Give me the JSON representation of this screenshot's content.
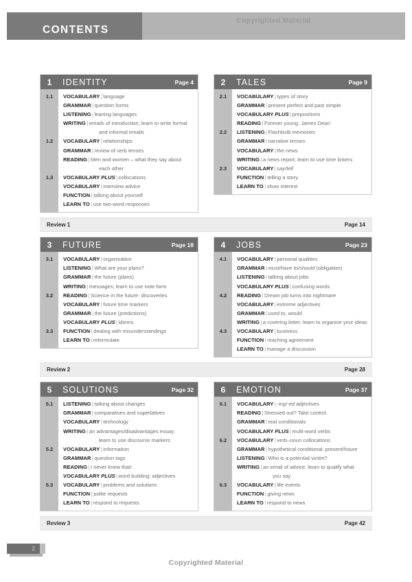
{
  "header": {
    "title": "CONTENTS",
    "watermark": "Copyrighted Material"
  },
  "footer": {
    "page_number": "2",
    "watermark": "Copyrighted Material"
  },
  "colors": {
    "header_dark": "#7a7a7a",
    "header_light": "#b3b3b3",
    "unit_head": "#6e6e6e",
    "lesson_col": "#bfbfbf",
    "review_bar": "#ececec"
  },
  "units": [
    {
      "number": "1",
      "title": "IDENTITY",
      "page_label": "Page 4",
      "lessons": [
        "1.1",
        "",
        "",
        "",
        "",
        "1.2",
        "",
        "",
        "",
        "1.3",
        "",
        ""
      ],
      "rows": [
        {
          "label": "VOCABULARY",
          "text": "language"
        },
        {
          "label": "GRAMMAR",
          "text": "question forms"
        },
        {
          "label": "LISTENING",
          "text": "leaning languages"
        },
        {
          "label": "WRITING",
          "text": "emails of introduction; learn to write formal",
          "cont": "and informal emails"
        },
        {
          "label": "VOCABULARY",
          "text": "relationships"
        },
        {
          "label": "GRAMMAR",
          "text": "review of verb tenses"
        },
        {
          "label": "READING",
          "text": "Men and women – what they say about",
          "cont": "each other"
        },
        {
          "label": "VOCABULARY PLUS",
          "text": "collocations"
        },
        {
          "label": "VOCABULARY",
          "text": "interview advice"
        },
        {
          "label": "FUNCTION",
          "text": "talking about yourself"
        },
        {
          "label": "LEARN TO",
          "text": "use two-word responses"
        }
      ]
    },
    {
      "number": "2",
      "title": "TALES",
      "page_label": "Page 9",
      "lessons": [
        "2.1",
        "",
        "",
        "",
        "2.2",
        "",
        "",
        "",
        "2.3",
        "",
        ""
      ],
      "rows": [
        {
          "label": "VOCABULARY",
          "text": "types of story"
        },
        {
          "label": "GRAMMAR",
          "text": "present perfect and past simple"
        },
        {
          "label": "VOCABULARY PLUS",
          "text": "prepositions"
        },
        {
          "label": "READING",
          "text": "Forever young: James Dean"
        },
        {
          "label": "LISTENING",
          "text": "Flashbulb memories"
        },
        {
          "label": "GRAMMAR",
          "text": "narrative tenses"
        },
        {
          "label": "VOCABULARY",
          "text": "the news"
        },
        {
          "label": "WRITING",
          "text": "a news report; learn to use time linkers"
        },
        {
          "label": "VOCABULARY",
          "text": "say/tell",
          "italic": true
        },
        {
          "label": "FUNCTION",
          "text": "telling a story"
        },
        {
          "label": "LEARN TO",
          "text": "show interest"
        }
      ]
    },
    {
      "number": "3",
      "title": "FUTURE",
      "page_label": "Page 18",
      "lessons": [
        "3.1",
        "",
        "",
        "",
        "3.2",
        "",
        "",
        "",
        "3.3",
        ""
      ],
      "rows": [
        {
          "label": "VOCABULARY",
          "text": "organisation"
        },
        {
          "label": "LISTENING",
          "text": "What are your plans?"
        },
        {
          "label": "GRAMMAR",
          "text": "the future (plans)"
        },
        {
          "label": "WRITING",
          "text": "messages; learn to use note form"
        },
        {
          "label": "READING",
          "text": "Science in the future: discoveries"
        },
        {
          "label": "VOCABULARY",
          "text": "future time markers"
        },
        {
          "label": "GRAMMAR",
          "text": "the future (predictions)"
        },
        {
          "label": "VOCABULARY PLUS",
          "text": "idioms"
        },
        {
          "label": "FUNCTION",
          "text": "dealing with misunderstandings"
        },
        {
          "label": "LEARN TO",
          "text": "reformulate"
        }
      ]
    },
    {
      "number": "4",
      "title": "JOBS",
      "page_label": "Page 23",
      "lessons": [
        "4.1",
        "",
        "",
        "",
        "4.2",
        "",
        "",
        "",
        "4.3",
        "",
        ""
      ],
      "rows": [
        {
          "label": "VOCABULARY",
          "text": "personal qualities"
        },
        {
          "label": "GRAMMAR",
          "text": "must/have to/should",
          "text_tail": " (obligation)",
          "italic": true
        },
        {
          "label": "LISTENING",
          "text": "talking about jobs"
        },
        {
          "label": "VOCABULARY PLUS",
          "text": "confusing words"
        },
        {
          "label": "READING",
          "text": "Dream job turns into nightmare"
        },
        {
          "label": "VOCABULARY",
          "text": "extreme adjectives"
        },
        {
          "label": "GRAMMAR",
          "text": "used to, would",
          "italic": true
        },
        {
          "label": "WRITING",
          "text": "a covering letter; learn to organise your ideas"
        },
        {
          "label": "VOCABULARY",
          "text": "business"
        },
        {
          "label": "FUNCTION",
          "text": "reaching agreement"
        },
        {
          "label": "LEARN TO",
          "text": "manage a discussion"
        }
      ]
    },
    {
      "number": "5",
      "title": "SOLUTIONS",
      "page_label": "Page 32",
      "lessons": [
        "5.1",
        "",
        "",
        "",
        "",
        "5.2",
        "",
        "",
        "",
        "5.3",
        "",
        ""
      ],
      "rows": [
        {
          "label": "LISTENING",
          "text": "talking about changes"
        },
        {
          "label": "GRAMMAR",
          "text": "comparatives and superlatives"
        },
        {
          "label": "VOCABULARY",
          "text": "technology"
        },
        {
          "label": "WRITING",
          "text": "an advantages/disadvantages essay;",
          "cont": "learn to use discourse markers"
        },
        {
          "label": "VOCABULARY",
          "text": "information"
        },
        {
          "label": "GRAMMAR",
          "text": "question tags"
        },
        {
          "label": "READING",
          "text": "I never knew that!"
        },
        {
          "label": "VOCABULARY PLUS",
          "text": "word building: adjectives"
        },
        {
          "label": "VOCABULARY",
          "text": "problems and solutions"
        },
        {
          "label": "FUNCTION",
          "text": "polite requests"
        },
        {
          "label": "LEARN TO",
          "text": "respond to requests"
        }
      ]
    },
    {
      "number": "6",
      "title": "EMOTION",
      "page_label": "Page 37",
      "lessons": [
        "6.1",
        "",
        "",
        "",
        "6.2",
        "",
        "",
        "",
        "",
        "6.3",
        "",
        ""
      ],
      "rows": [
        {
          "label": "VOCABULARY",
          "text": "-ing/-ed",
          "text_tail": " adjectives",
          "italic": true
        },
        {
          "label": "READING",
          "text": "Stressed out? Take control."
        },
        {
          "label": "GRAMMAR",
          "text": "real conditionals"
        },
        {
          "label": "VOCABULARY PLUS",
          "text": "multi-word verbs"
        },
        {
          "label": "VOCABULARY",
          "text": "verb–noun collocations"
        },
        {
          "label": "GRAMMAR",
          "text": "hypothetical conditional: present/future"
        },
        {
          "label": "LISTENING",
          "text": "Who is a potential victim?"
        },
        {
          "label": "WRITING",
          "text": "an email of advice; learn to qualify what",
          "cont": "you say"
        },
        {
          "label": "VOCABULARY",
          "text": "life events"
        },
        {
          "label": "FUNCTION",
          "text": "giving news"
        },
        {
          "label": "LEARN TO",
          "text": "respond to news"
        }
      ]
    }
  ],
  "reviews": [
    {
      "label": "Review 1",
      "page_label": "Page 14"
    },
    {
      "label": "Review 2",
      "page_label": "Page 28"
    },
    {
      "label": "Review 3",
      "page_label": "Page 42"
    }
  ]
}
